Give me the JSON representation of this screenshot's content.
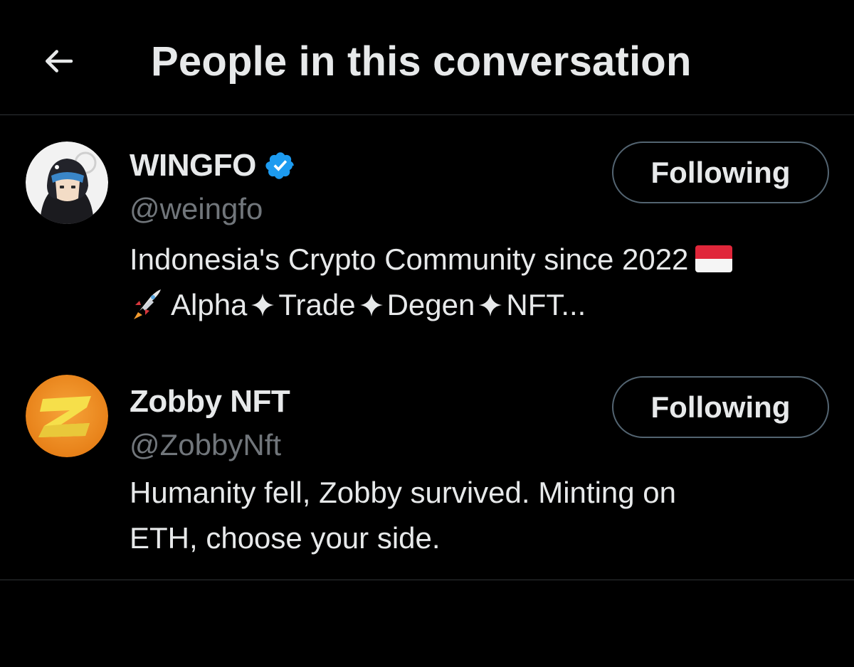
{
  "header": {
    "title": "People in this conversation",
    "back_icon": "arrow-left-icon"
  },
  "users": [
    {
      "display_name": "WINGFO",
      "verified": true,
      "handle": "@weingfo",
      "bio_line1": "Indonesia's Crypto Community since 2022",
      "bio_line2_parts": [
        "Alpha",
        "Trade",
        "Degen",
        "NFT..."
      ],
      "follow_label": "Following",
      "avatar_icon": "hooded-character-avatar"
    },
    {
      "display_name": "Zobby NFT",
      "verified": false,
      "handle": "@ZobbyNft",
      "bio_line1": "Humanity fell, Zobby survived. Minting on",
      "bio_line2": "ETH, choose your side.",
      "follow_label": "Following",
      "avatar_icon": "z-logo-avatar"
    }
  ],
  "colors": {
    "background": "#000000",
    "text_primary": "#e7e9ea",
    "text_secondary": "#71767b",
    "border": "#2f3336",
    "verified_blue": "#1d9bf0"
  }
}
